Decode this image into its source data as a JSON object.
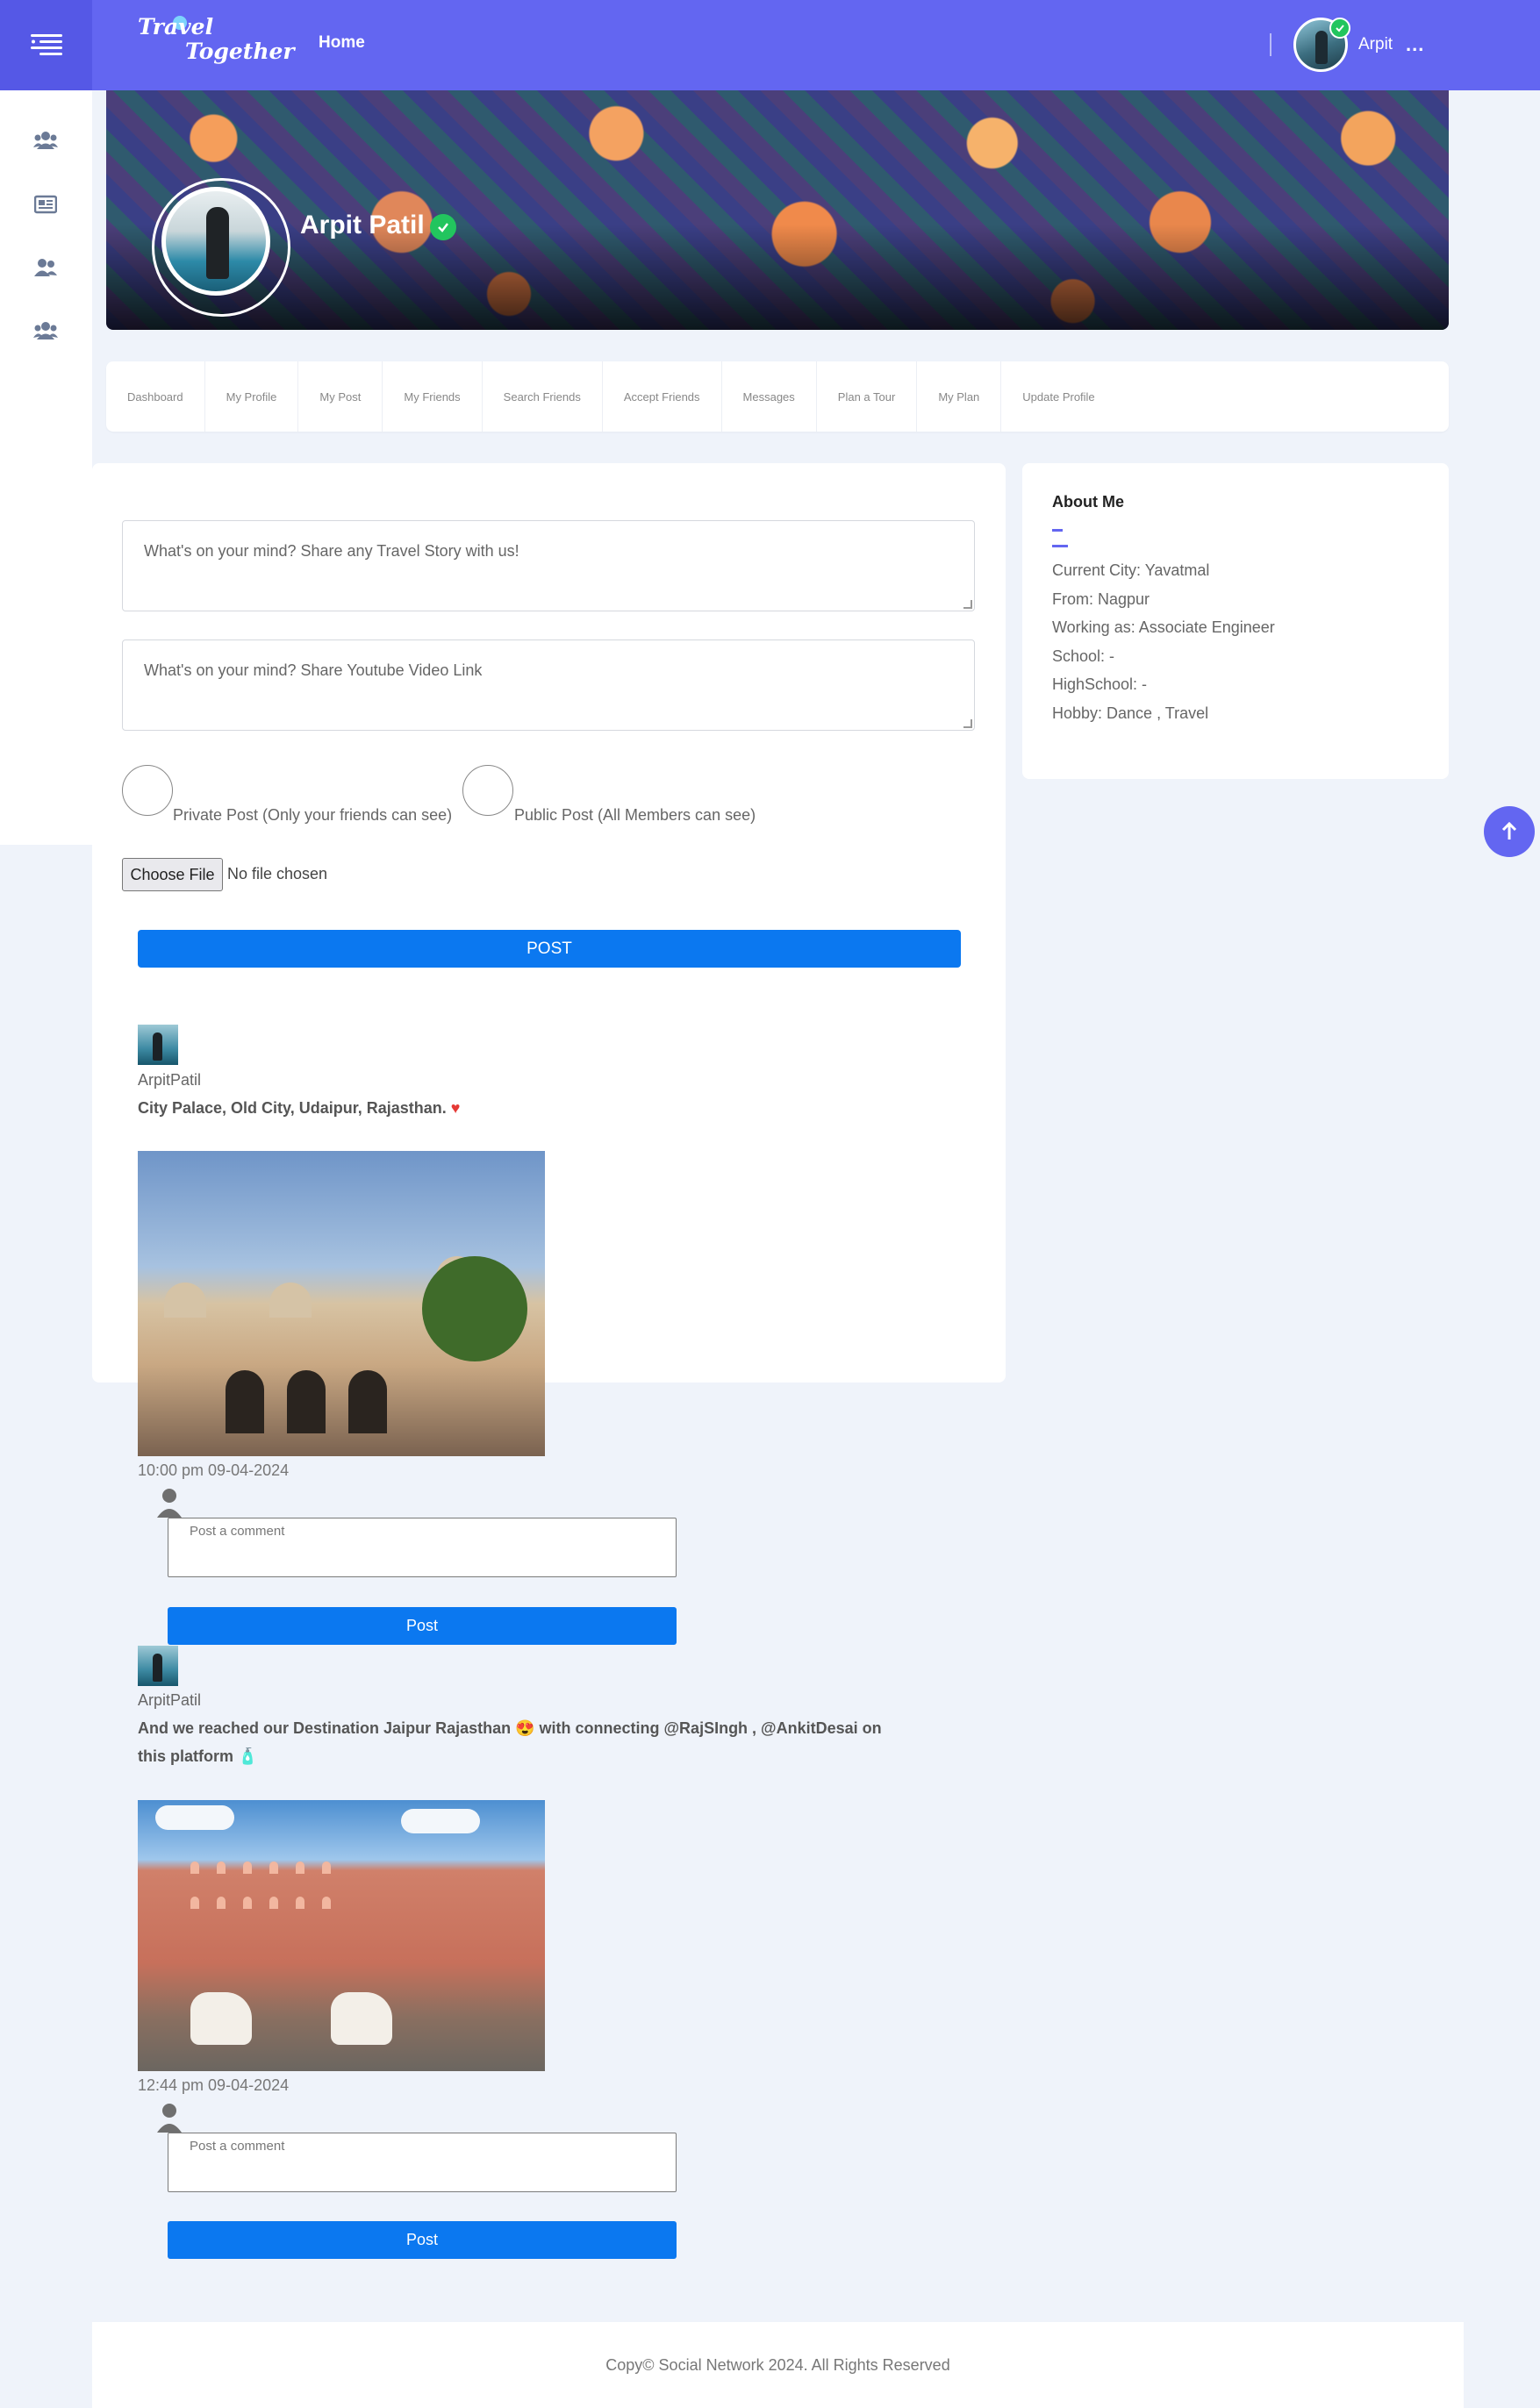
{
  "header": {
    "logo_line1": "Travel",
    "logo_line2": "Together",
    "nav_home": "Home",
    "user_name": "Arpit",
    "more_label": "..."
  },
  "sidebar": {
    "icons": [
      "groups-icon",
      "newspaper-icon",
      "user-friends-icon",
      "groups-icon"
    ]
  },
  "profile": {
    "name": "Arpit Patil",
    "verified": true
  },
  "tabs": [
    "Dashboard",
    "My Profile",
    "My Post",
    "My Friends",
    "Search Friends",
    "Accept Friends",
    "Messages",
    "Plan a Tour",
    "My Plan",
    "Update Profile"
  ],
  "composer": {
    "story_placeholder": "What's on your mind? Share any Travel Story with us!",
    "video_placeholder": "What's on your mind? Share Youtube Video Link",
    "private_label": "Private Post (Only your friends can see)",
    "public_label": "Public Post (All Members can see)",
    "choose_file": "Choose File",
    "file_status": "No file chosen",
    "post_button": "POST"
  },
  "posts": [
    {
      "user": "ArpitPatil",
      "text": "City Palace, Old City, Udaipur, Rajasthan.",
      "emoji": "♥",
      "time": "10:00 pm 09-04-2024",
      "comment_placeholder": "Post a comment",
      "post_button": "Post"
    },
    {
      "user": "ArpitPatil",
      "text_line1": "And we reached our Destination Jaipur Rajasthan 😍 with connecting @RajSIngh , @AnkitDesai on",
      "text_line2": "this platform 🧴",
      "time": "12:44 pm 09-04-2024",
      "comment_placeholder": "Post a comment",
      "post_button": "Post"
    }
  ],
  "about": {
    "title": "About Me",
    "lines": [
      "Current City: Yavatmal",
      "From: Nagpur",
      "Working as: Associate Engineer",
      "School: -",
      "HighSchool: -",
      "Hobby: Dance , Travel"
    ]
  },
  "footer": {
    "text": "Copy© Social Network 2024. All Rights Reserved"
  },
  "colors": {
    "primary": "#6366f1",
    "button_blue": "#0b78f0",
    "verified_green": "#22c55e",
    "page_bg": "#eff3fa"
  }
}
